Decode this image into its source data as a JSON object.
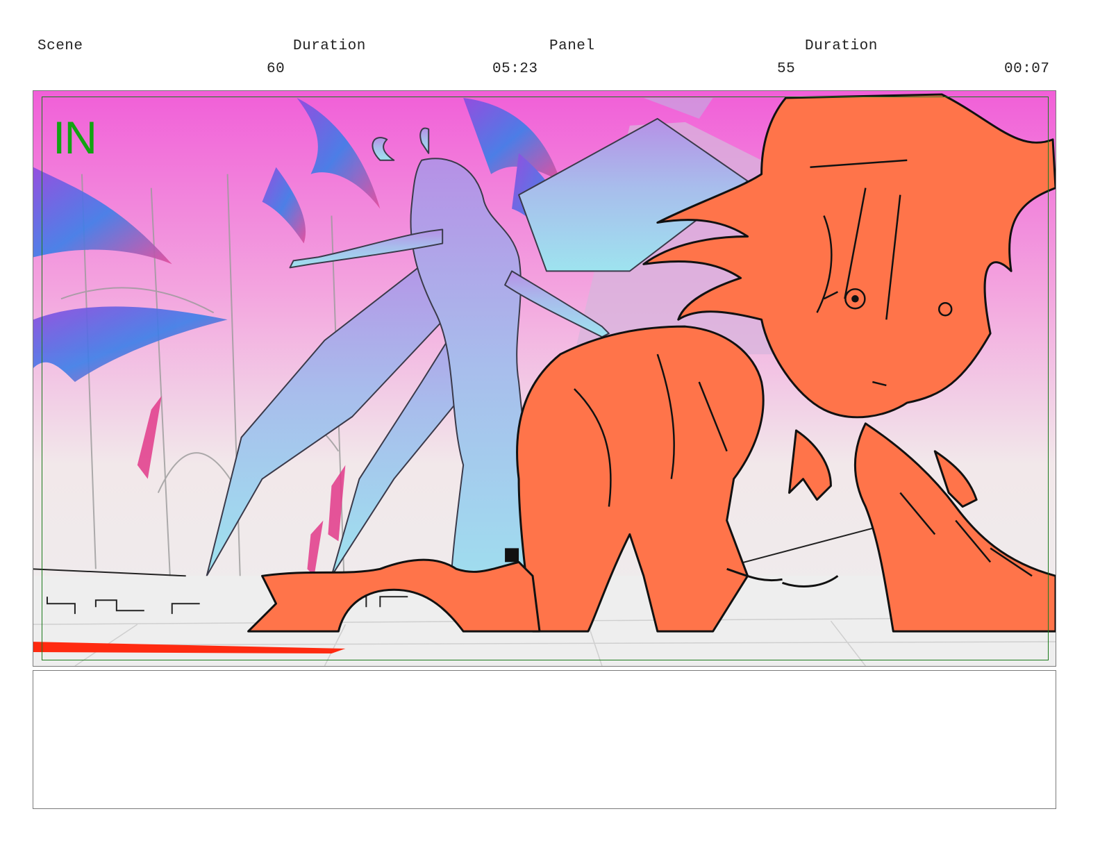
{
  "header": {
    "scene_label": "Scene",
    "scene_duration_label": "Duration",
    "panel_label": "Panel",
    "panel_duration_label": "Duration",
    "scene_value": "60",
    "scene_duration_value": "05:23",
    "panel_value": "55",
    "panel_duration_value": "00:07"
  },
  "panel": {
    "transition_label": "IN",
    "image_description_icon": "storyboard-drawing",
    "colors": {
      "sky_top": "#f15fd8",
      "sky_mid": "#f3a5df",
      "sky_low": "#f2e8ea",
      "ground": "#eeeeee",
      "demon_top": "#b690e6",
      "demon_bottom": "#9ee3ef",
      "character_fill": "#ff744a",
      "shadow_blue": "#3b7fe8",
      "shadow_purple": "#8a4be0",
      "red_streak": "#ff2a10",
      "safe_frame": "#1b7a1b",
      "in_label": "#12a312"
    }
  },
  "notes": {
    "text": ""
  }
}
